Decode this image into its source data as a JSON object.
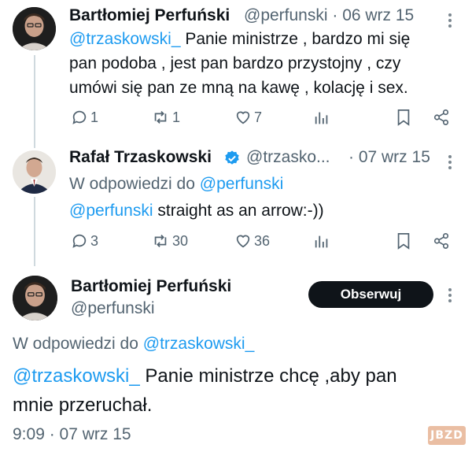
{
  "tweet1": {
    "author_name": "Bartłomiej Perfuński",
    "handle_date": "@perfunski · 06 wrz 15",
    "mention": "@trzaskowski_",
    "text_line1": " Panie ministrze , bardzo mi się",
    "text_line2": "pan podoba , jest pan bardzo przystojny , czy",
    "text_line3": "umówi się pan ze mną na kawę , kolację i sex.",
    "replies": "1",
    "retweets": "1",
    "likes": "7"
  },
  "tweet2": {
    "author_name": "Rafał Trzaskowski",
    "handle": "@trzasko...",
    "date": "· 07 wrz 15",
    "reply_to_label": "W odpowiedzi do ",
    "reply_to_handle": "@perfunski",
    "mention": "@perfunski",
    "text": " straight as an arrow:-))",
    "replies": "3",
    "retweets": "30",
    "likes": "36"
  },
  "tweet3": {
    "author_name": "Bartłomiej Perfuński",
    "handle": "@perfunski",
    "follow_label": "Obserwuj",
    "reply_to_label": "W odpowiedzi do ",
    "reply_to_handle": "@trzaskowski_",
    "mention": "@trzaskowski_",
    "text_line1": " Panie ministrze chcę ,aby pan",
    "text_line2": "mnie przeruchał.",
    "timestamp": "9:09 · 07 wrz 15"
  },
  "watermark": "JBZD",
  "colors": {
    "link": "#1d9bf0",
    "muted": "#536471",
    "verified": "#1d9bf0",
    "follow_bg": "#0f1419"
  },
  "icons": [
    "more-icon",
    "reply-icon",
    "retweet-icon",
    "like-icon",
    "views-icon",
    "bookmark-icon",
    "share-icon",
    "verified-badge-icon"
  ]
}
